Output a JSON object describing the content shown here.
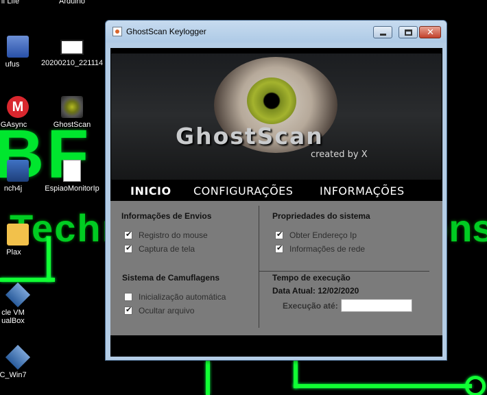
{
  "desktop": {
    "icons": [
      {
        "label": "lf Life"
      },
      {
        "label": "Arduino"
      },
      {
        "label": "ufus"
      },
      {
        "label": "20200210_221114"
      },
      {
        "label": "GAsync"
      },
      {
        "label": "GhostScan"
      },
      {
        "label": "nch4j"
      },
      {
        "label": "EspiaoMonitorIp"
      },
      {
        "label": "Plax"
      },
      {
        "label": "cle VM"
      },
      {
        "label": "ualBox"
      },
      {
        "label": "C_Win7"
      }
    ],
    "wallpaper": {
      "letters": "BF",
      "text_left": "Techn",
      "text_right": "ons",
      "accent": "#00ff33"
    }
  },
  "window": {
    "title": "GhostScan Keylogger",
    "banner": {
      "logo": "GhostScan",
      "subtitle": "created by X"
    },
    "nav": [
      {
        "label": "Inicio",
        "active": true
      },
      {
        "label": "Configurações",
        "active": false
      },
      {
        "label": "Informações",
        "active": false
      }
    ],
    "envios": {
      "title": "Informações de Envios",
      "options": [
        {
          "label": "Registro do mouse",
          "checked": true
        },
        {
          "label": "Captura de tela",
          "checked": true
        }
      ]
    },
    "sistema": {
      "title": "Propriedades do sistema",
      "options": [
        {
          "label": "Obter Endereço Ip",
          "checked": true
        },
        {
          "label": "Informações de rede",
          "checked": true
        }
      ]
    },
    "camuflagens": {
      "title": "Sistema de Camuflagens",
      "options": [
        {
          "label": "Inicialização automática",
          "checked": false
        },
        {
          "label": "Ocultar arquivo",
          "checked": true
        }
      ]
    },
    "tempo": {
      "title": "Tempo de execução",
      "data_atual": "Data Atual: 12/02/2020",
      "execucao_label": "Execução até:",
      "execucao_value": ""
    }
  }
}
